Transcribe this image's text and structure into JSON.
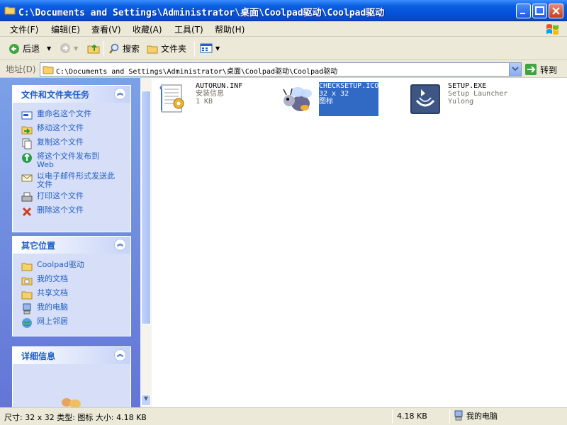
{
  "window": {
    "title": "C:\\Documents and Settings\\Administrator\\桌面\\Coolpad驱动\\Coolpad驱动"
  },
  "menu": [
    "文件(F)",
    "编辑(E)",
    "查看(V)",
    "收藏(A)",
    "工具(T)",
    "帮助(H)"
  ],
  "toolbar": {
    "back_label": "后退",
    "search_label": "搜索",
    "folders_label": "文件夹"
  },
  "address": {
    "label": "地址(D)",
    "path": "C:\\Documents and Settings\\Administrator\\桌面\\Coolpad驱动\\Coolpad驱动",
    "go_label": "转到"
  },
  "panels": {
    "tasks": {
      "title": "文件和文件夹任务",
      "items": [
        {
          "label": "重命名这个文件",
          "icon": "rename-icon"
        },
        {
          "label": "移动这个文件",
          "icon": "move-icon"
        },
        {
          "label": "复制这个文件",
          "icon": "copy-icon"
        },
        {
          "label": "将这个文件发布到Web",
          "icon": "publish-web-icon"
        },
        {
          "label": "以电子邮件形式发送此文件",
          "icon": "email-icon"
        },
        {
          "label": "打印这个文件",
          "icon": "print-icon"
        },
        {
          "label": "删除这个文件",
          "icon": "delete-icon"
        }
      ]
    },
    "places": {
      "title": "其它位置",
      "items": [
        {
          "label": "Coolpad驱动",
          "icon": "folder-icon"
        },
        {
          "label": "我的文档",
          "icon": "my-documents-icon"
        },
        {
          "label": "共享文档",
          "icon": "shared-folder-icon"
        },
        {
          "label": "我的电脑",
          "icon": "my-computer-icon"
        },
        {
          "label": "网上邻居",
          "icon": "network-icon"
        }
      ]
    },
    "details": {
      "title": "详细信息"
    }
  },
  "files": [
    {
      "name": "AUTORUN.INF",
      "line2": "安装信息",
      "line3": "1 KB",
      "icon": "setup-info-icon",
      "selected": false
    },
    {
      "name": "CHECKSETUP.ICO",
      "line2": "32 x 32",
      "line3": "图标",
      "icon": "bug-icon",
      "selected": true
    },
    {
      "name": "SETUP.EXE",
      "line2": "Setup Launcher",
      "line3": "Yulong",
      "icon": "setup-launcher-icon",
      "selected": false
    }
  ],
  "status": {
    "info": "尺寸: 32 x 32 类型: 图标 大小: 4.18 KB",
    "size": "4.18 KB",
    "zone": "我的电脑"
  },
  "colors": {
    "titlebar": "#0a5ee0",
    "panel_bg": "#d6dff7",
    "link": "#215dc6",
    "selection": "#316ac5"
  }
}
